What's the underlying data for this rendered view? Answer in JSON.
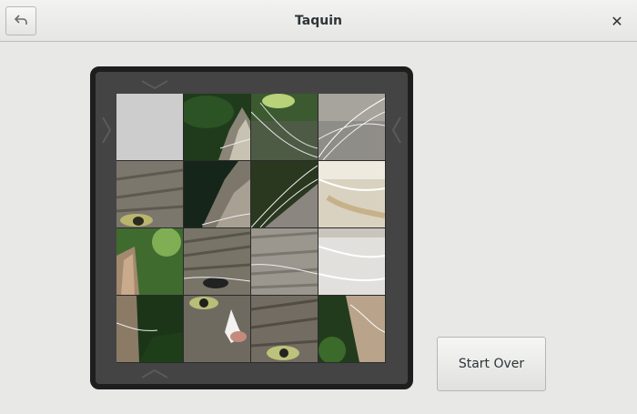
{
  "window": {
    "title": "Taquin",
    "back_icon": "undo-arrow-icon",
    "close_icon": "close-icon",
    "close_glyph": "✕"
  },
  "game": {
    "grid_size": 4,
    "empty_tile": {
      "row": 0,
      "col": 0
    },
    "tiles": [
      [
        "empty",
        "cat-ear-dark-green",
        "cat-whiskers-green-top",
        "cat-whiskers-grey"
      ],
      [
        "cat-eye-left-grey",
        "cat-ear-dark",
        "cat-whiskers-dark",
        "cat-fur-cream"
      ],
      [
        "cat-ear-green",
        "cat-nose-fur",
        "cat-fur-grey",
        "cat-fur-white"
      ],
      [
        "cat-ear-bottom",
        "cat-eye-nose",
        "cat-eye-right",
        "cat-fur-green-bottom"
      ]
    ],
    "arrows": {
      "top": "chevron-down-icon",
      "bottom": "chevron-up-icon",
      "left": "chevron-right-icon",
      "right": "chevron-left-icon"
    }
  },
  "actions": {
    "start_over_label": "Start Over"
  },
  "colors": {
    "header_bg": "#ececeb",
    "window_bg": "#e8e8e7",
    "board_bg": "#444444",
    "board_border": "#1e1e1e",
    "empty_tile": "#cdcdcd"
  }
}
